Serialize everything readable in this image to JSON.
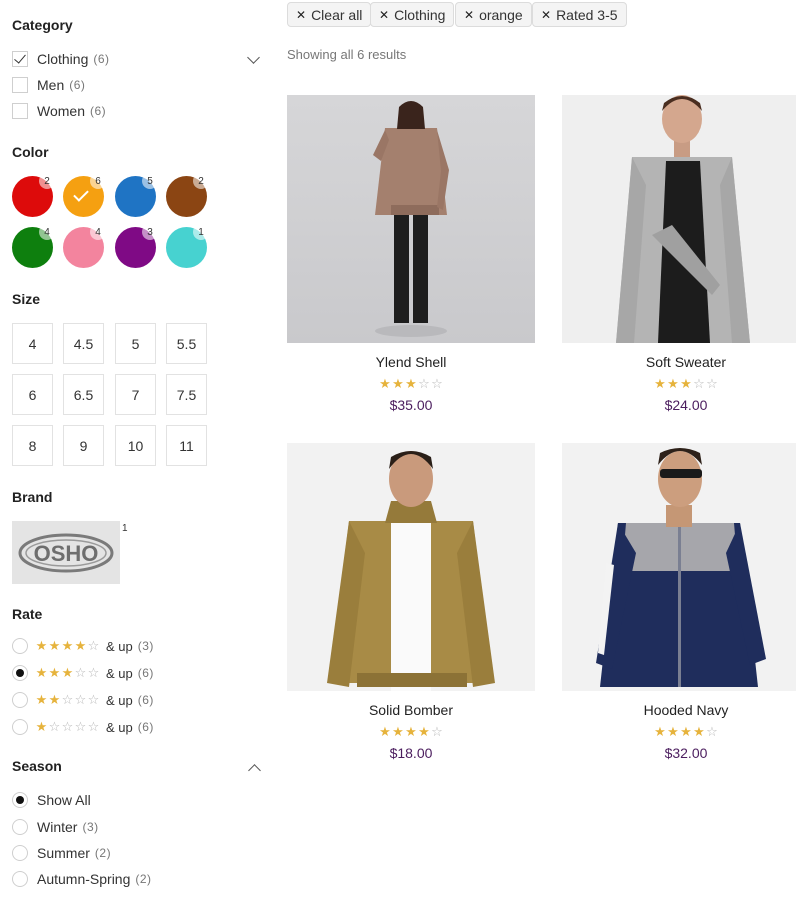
{
  "sidebar": {
    "category": {
      "title": "Category",
      "items": [
        {
          "label": "Clothing",
          "count": "(6)",
          "checked": true
        },
        {
          "label": "Men",
          "count": "(6)",
          "checked": false
        },
        {
          "label": "Women",
          "count": "(6)",
          "checked": false
        }
      ]
    },
    "color": {
      "title": "Color",
      "swatches": [
        {
          "name": "red",
          "hex": "#dd0b0b",
          "count": "2",
          "selected": false
        },
        {
          "name": "orange",
          "hex": "#f5a011",
          "count": "6",
          "selected": true
        },
        {
          "name": "blue",
          "hex": "#1f74c4",
          "count": "5",
          "selected": false
        },
        {
          "name": "brown",
          "hex": "#8b4513",
          "count": "2",
          "selected": false
        },
        {
          "name": "green",
          "hex": "#0e7f0e",
          "count": "4",
          "selected": false
        },
        {
          "name": "pink",
          "hex": "#f3849e",
          "count": "4",
          "selected": false
        },
        {
          "name": "purple",
          "hex": "#7f0a85",
          "count": "3",
          "selected": false
        },
        {
          "name": "turquoise",
          "hex": "#47d2d0",
          "count": "1",
          "selected": false
        }
      ]
    },
    "size": {
      "title": "Size",
      "options": [
        "4",
        "4.5",
        "5",
        "5.5",
        "6",
        "6.5",
        "7",
        "7.5",
        "8",
        "9",
        "10",
        "11"
      ]
    },
    "brand": {
      "title": "Brand",
      "logo_text": "OSHO",
      "count": "1"
    },
    "rate": {
      "title": "Rate",
      "items": [
        {
          "stars": 4,
          "label": "& up",
          "count": "(3)",
          "selected": false
        },
        {
          "stars": 3,
          "label": "& up",
          "count": "(6)",
          "selected": true
        },
        {
          "stars": 2,
          "label": "& up",
          "count": "(6)",
          "selected": false
        },
        {
          "stars": 1,
          "label": "& up",
          "count": "(6)",
          "selected": false
        }
      ]
    },
    "season": {
      "title": "Season",
      "items": [
        {
          "label": "Show All",
          "count": "",
          "selected": true
        },
        {
          "label": "Winter",
          "count": "(3)",
          "selected": false
        },
        {
          "label": "Summer",
          "count": "(2)",
          "selected": false
        },
        {
          "label": "Autumn-Spring",
          "count": "(2)",
          "selected": false
        }
      ]
    }
  },
  "filters": {
    "chips": [
      {
        "label": "Clear all"
      },
      {
        "label": "Clothing"
      },
      {
        "label": "orange"
      },
      {
        "label": "Rated 3-5"
      }
    ],
    "results_text": "Showing all 6 results"
  },
  "products": [
    {
      "name": "Ylend Shell",
      "rating": 3,
      "price": "$35.00"
    },
    {
      "name": "Soft Sweater",
      "rating": 3,
      "price": "$24.00"
    },
    {
      "name": "Solid Bomber",
      "rating": 4,
      "price": "$18.00"
    },
    {
      "name": "Hooded Navy",
      "rating": 4,
      "price": "$32.00"
    }
  ],
  "colors": {
    "star_full": "#e6b33c",
    "star_empty": "#b8b8b8",
    "price": "#4b1d5e"
  }
}
